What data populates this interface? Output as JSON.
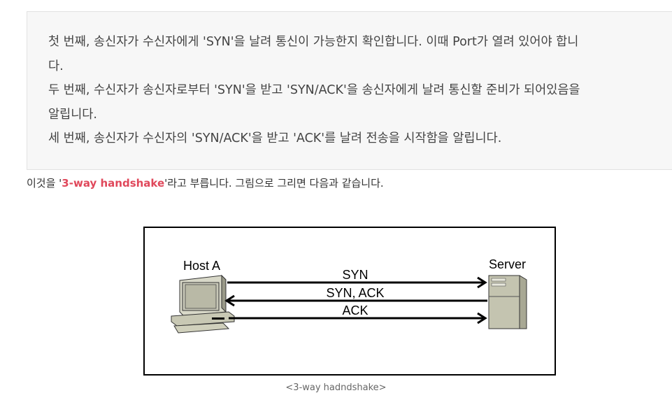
{
  "quote": {
    "lines": [
      "첫 번째, 송신자가 수신자에게 'SYN'을 날려 통신이 가능한지 확인합니다. 이때 Port가 열려 있어야 합니",
      "다.",
      "두 번째, 수신자가 송신자로부터 'SYN'을 받고 'SYN/ACK'을 송신자에게 날려 통신할 준비가 되어있음을",
      "알립니다.",
      "세 번째, 송신자가 수신자의 'SYN/ACK'을 받고 'ACK'를 날려 전송을 시작함을 알립니다."
    ]
  },
  "intro": {
    "before": "이것을 '",
    "highlight": "3-way handshake",
    "after": "'라고 부릅니다. 그림으로 그리면 다음과 같습니다."
  },
  "diagram": {
    "host_label": "Host A",
    "server_label": "Server",
    "messages": [
      {
        "label": "SYN",
        "direction": "to-server"
      },
      {
        "label": "SYN, ACK",
        "direction": "to-host"
      },
      {
        "label": "ACK",
        "direction": "to-server"
      }
    ]
  },
  "caption": "<3-way hadndshake>",
  "colors": {
    "highlight": "#e0485b",
    "quote_bg": "#f7f7f7"
  }
}
